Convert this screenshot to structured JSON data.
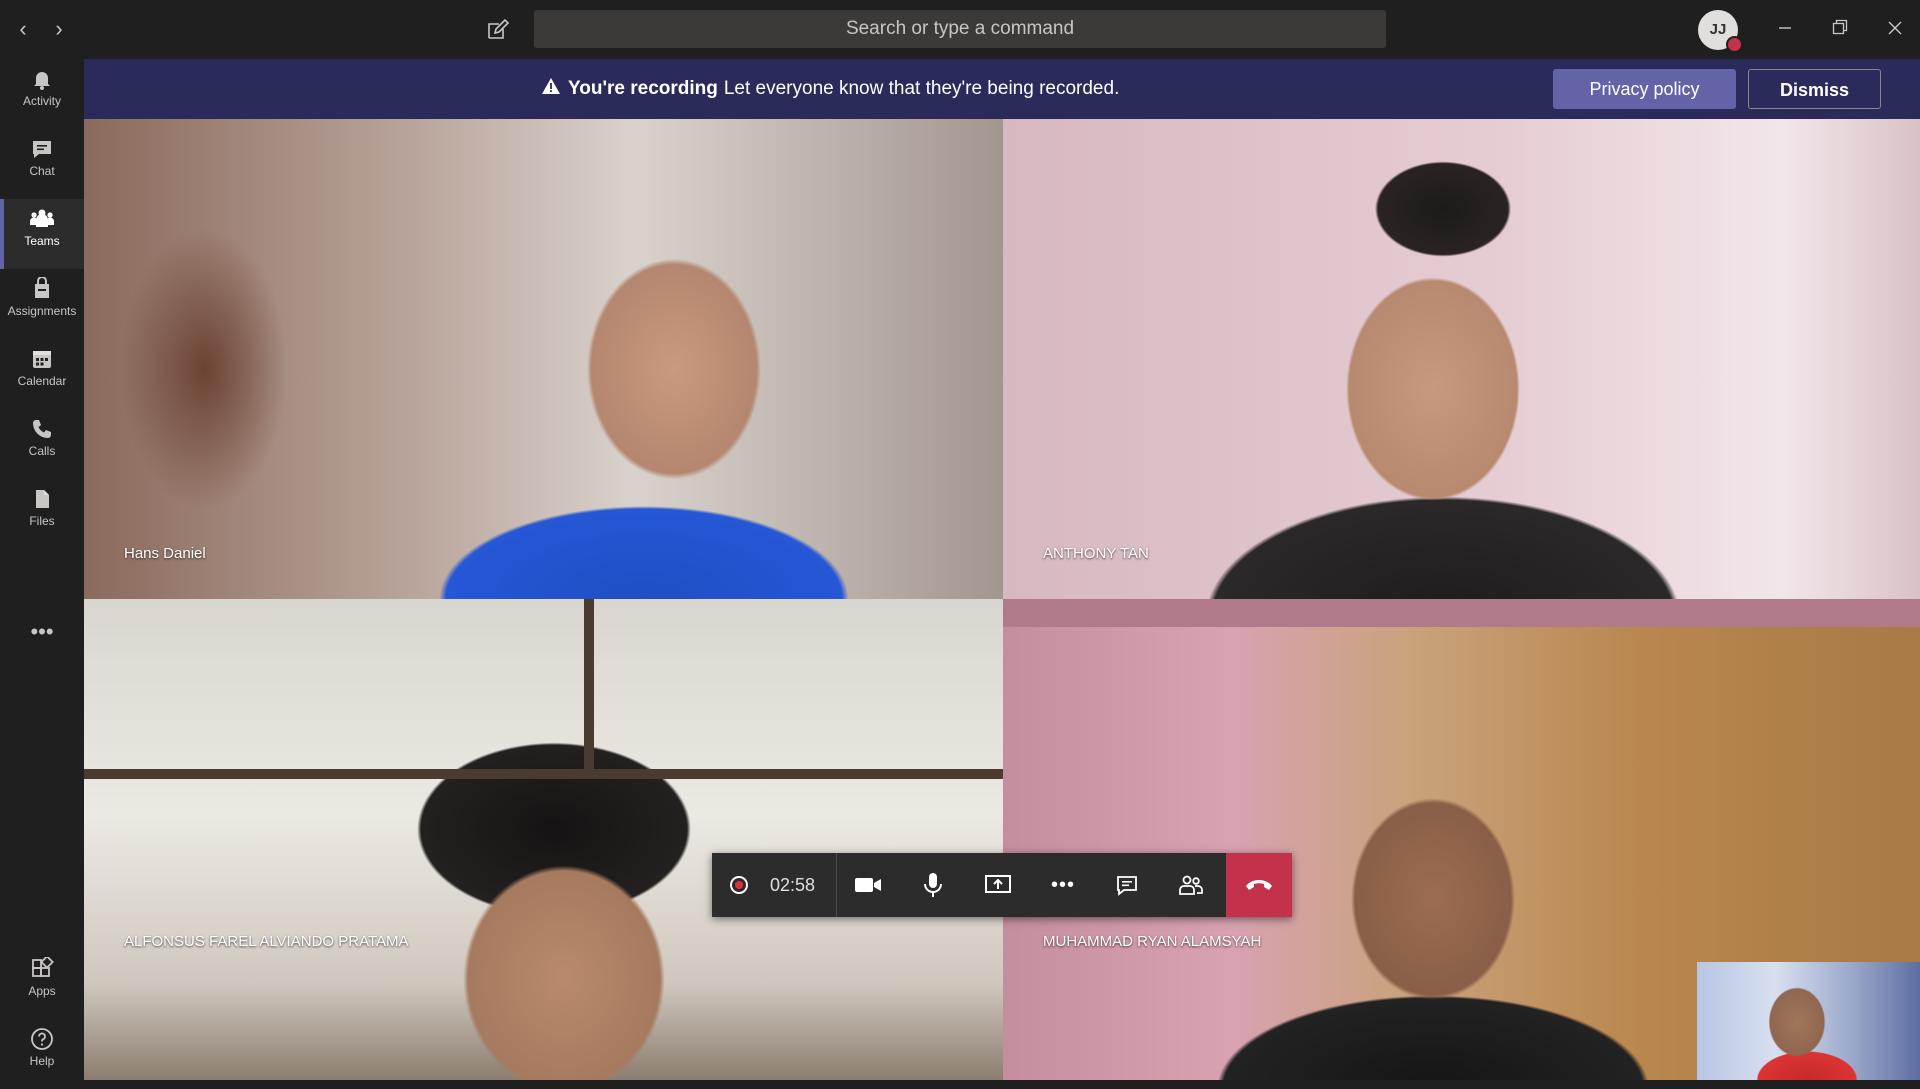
{
  "titlebar": {
    "search_placeholder": "Search or type a command",
    "avatar_initials": "JJ",
    "back_glyph": "‹",
    "forward_glyph": "›",
    "minimize_glyph": "—",
    "maximize_glyph": "❐",
    "close_glyph": "✕"
  },
  "rail": {
    "items": [
      {
        "label": "Activity",
        "icon": "bell-icon"
      },
      {
        "label": "Chat",
        "icon": "chat-icon"
      },
      {
        "label": "Teams",
        "icon": "teams-icon",
        "active": true
      },
      {
        "label": "Assignments",
        "icon": "assignments-icon"
      },
      {
        "label": "Calendar",
        "icon": "calendar-icon"
      },
      {
        "label": "Calls",
        "icon": "phone-icon"
      },
      {
        "label": "Files",
        "icon": "files-icon"
      }
    ],
    "more_glyph": "•••",
    "apps_label": "Apps",
    "help_label": "Help"
  },
  "banner": {
    "title": "You're recording",
    "message": "Let everyone know that they're being recorded.",
    "privacy_button": "Privacy policy",
    "dismiss_button": "Dismiss"
  },
  "participants": [
    {
      "name": "Hans Daniel"
    },
    {
      "name": "ANTHONY TAN"
    },
    {
      "name": "ALFONSUS FAREL ALVIANDO PRATAMA"
    },
    {
      "name": "MUHAMMAD RYAN ALAMSYAH"
    }
  ],
  "controls": {
    "timer": "02:58",
    "more_glyph": "•••"
  },
  "colors": {
    "accent": "#6264a7",
    "banner_bg": "#2a2b5a",
    "hangup": "#c4314b",
    "recording": "#e02f3b"
  }
}
